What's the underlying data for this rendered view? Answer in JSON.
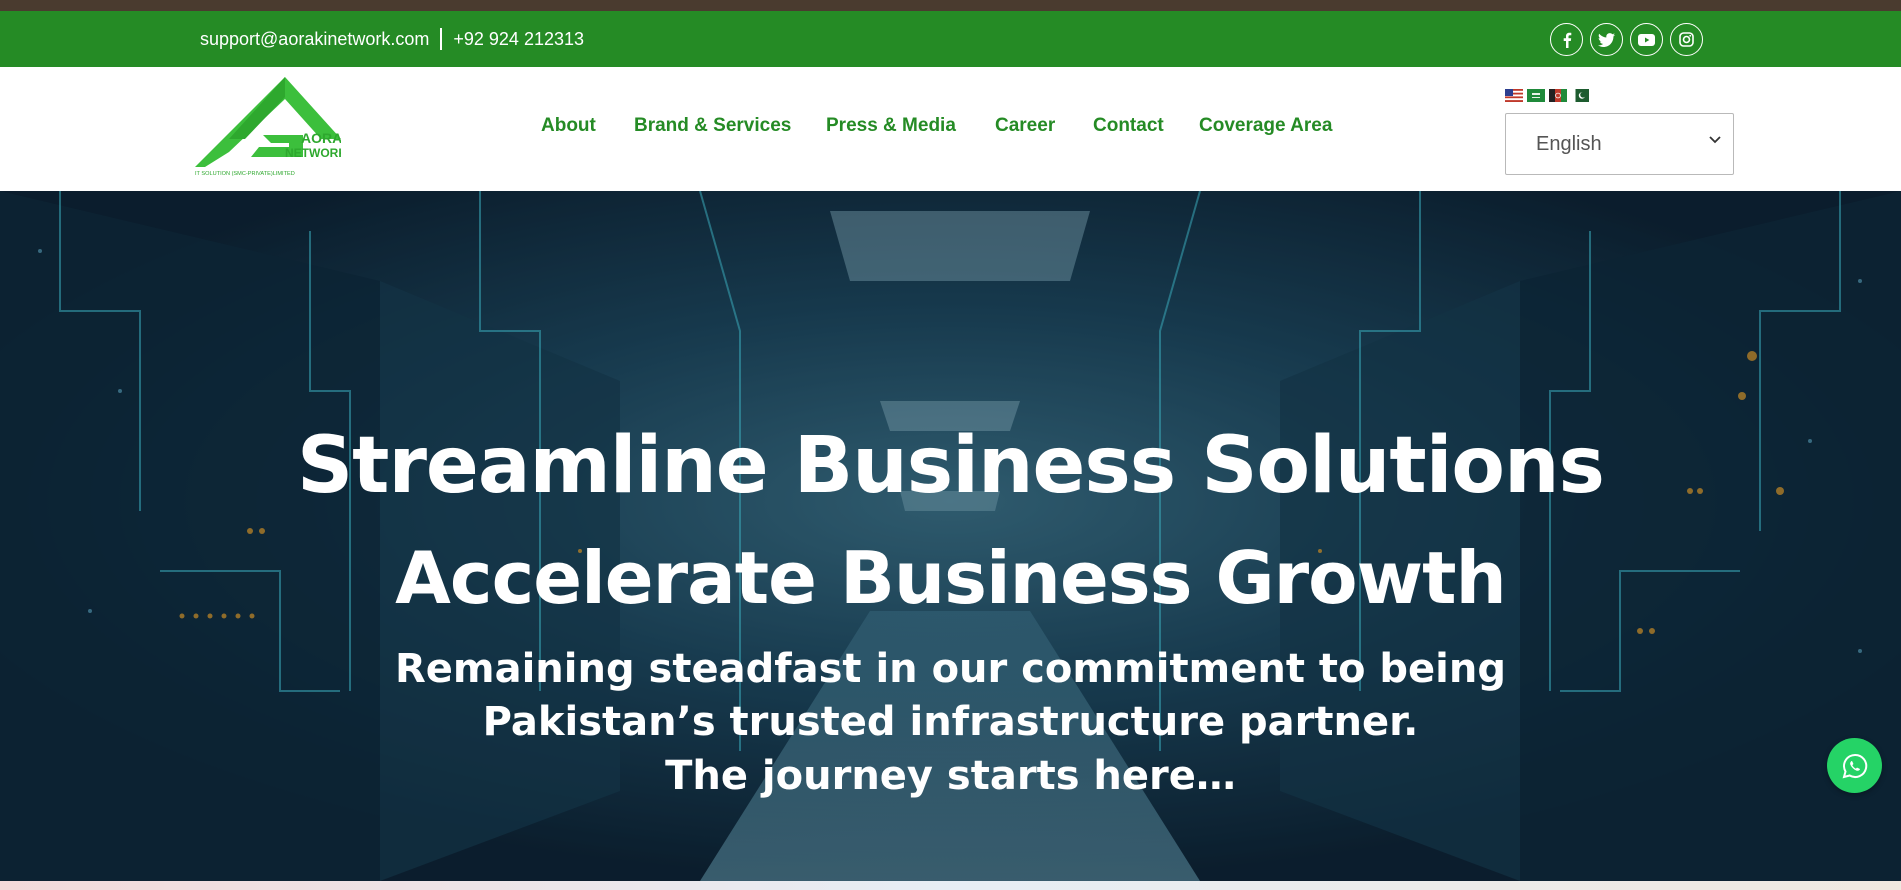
{
  "topbar": {
    "email": "support@aorakinetwork.com",
    "phone": "+92 924 212313",
    "socials": [
      "facebook-icon",
      "twitter-icon",
      "youtube-icon",
      "instagram-icon"
    ]
  },
  "logo": {
    "line1": "AORAKI",
    "line2": "NETWORK",
    "line3": "IT SOLUTION (SMC-PRIVATE)LIMITED"
  },
  "nav": {
    "items": [
      {
        "label": "About"
      },
      {
        "label": "Brand & Services"
      },
      {
        "label": "Press & Media"
      },
      {
        "label": "Career"
      },
      {
        "label": "Contact"
      },
      {
        "label": "Coverage Area"
      }
    ]
  },
  "language": {
    "selected": "English",
    "flags": [
      "us-flag-icon",
      "saudi-flag-icon",
      "afghanistan-flag-icon",
      "pakistan-flag-icon"
    ]
  },
  "hero": {
    "title_line1": "Streamline Business Solutions",
    "title_line2": "Accelerate Business Growth",
    "subtitle_line1": "Remaining steadfast in our commitment to being",
    "subtitle_line2": "Pakistan’s trusted infrastructure partner.",
    "subtitle_line3": "The journey starts here…"
  },
  "colors": {
    "brand_green": "#258b25",
    "top_strip": "#4a3b2f",
    "hero_bg": "#0f2a3c",
    "whatsapp": "#25d366"
  }
}
